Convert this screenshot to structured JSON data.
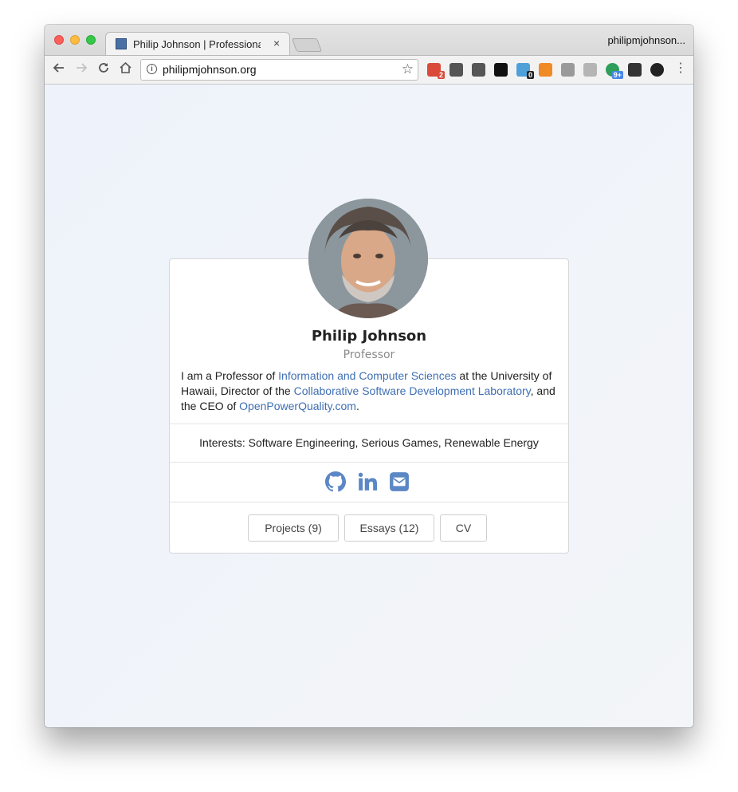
{
  "browser": {
    "tab_title": "Philip Johnson | Professional P",
    "tab_close": "×",
    "profile_name": "philipmjohnson...",
    "url": "philipmjohnson.org",
    "extensions": [
      {
        "name": "extension-red-icon",
        "badge": "2",
        "color": "#d94a3a",
        "badge_color": "#d94a3a"
      },
      {
        "name": "extension-sync-icon",
        "badge": "",
        "color": "#555555",
        "badge_color": ""
      },
      {
        "name": "extension-info-icon",
        "badge": "",
        "color": "#555555",
        "badge_color": ""
      },
      {
        "name": "extension-jb-icon",
        "badge": "",
        "color": "#111111",
        "badge_color": ""
      },
      {
        "name": "extension-ghost-icon",
        "badge": "0",
        "color": "#4ea0d8",
        "badge_color": "#222222"
      },
      {
        "name": "extension-chart-icon",
        "badge": "",
        "color": "#f08a24",
        "badge_color": ""
      },
      {
        "name": "extension-camera-icon",
        "badge": "",
        "color": "#9a9a9a",
        "badge_color": ""
      },
      {
        "name": "extension-drive-icon",
        "badge": "",
        "color": "#b5b5b5",
        "badge_color": ""
      },
      {
        "name": "extension-green-icon",
        "badge": "9+",
        "color": "#2e9e5b",
        "badge_color": "#4a86e8"
      },
      {
        "name": "extension-eyedropper-icon",
        "badge": "",
        "color": "#333333",
        "badge_color": ""
      },
      {
        "name": "extension-color-icon",
        "badge": "",
        "color": "#222222",
        "badge_color": ""
      }
    ]
  },
  "profile": {
    "name": "Philip Johnson",
    "title": "Professor",
    "bio_parts": {
      "p1": "I am a Professor of ",
      "link1": "Information and Computer Sciences",
      "p2": " at the University of Hawaii, Director of the ",
      "link2": "Collaborative Software Development Laboratory",
      "p3": ", and the CEO of ",
      "link3": "OpenPowerQuality.com",
      "p4": "."
    },
    "interests": "Interests: Software Engineering, Serious Games, Renewable Energy"
  },
  "buttons": {
    "projects": "Projects (9)",
    "essays": "Essays (12)",
    "cv": "CV"
  },
  "colors": {
    "link": "#3f6fb3",
    "social_icon": "#5b87c5"
  }
}
